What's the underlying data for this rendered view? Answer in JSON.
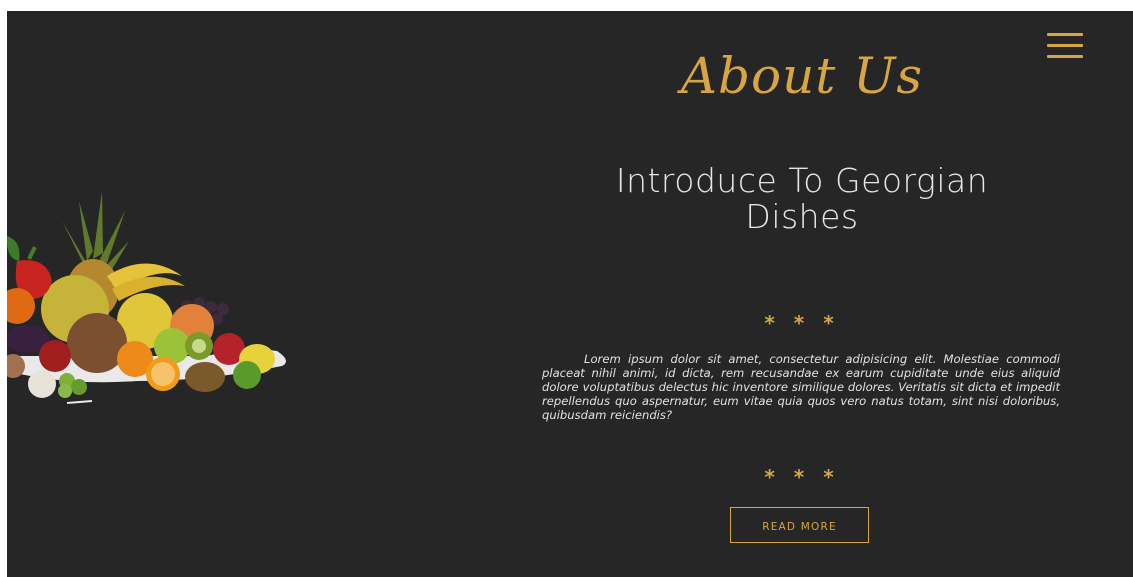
{
  "section": {
    "script_title": "About Us",
    "heading": "Introduce To Georgian Dishes",
    "stars_top": "* * *",
    "body": "Lorem ipsum dolor sit amet, consectetur adipisicing elit. Molestiae commodi placeat nihil animi, id dicta, rem recusandae ex earum cupiditate unde eius aliquid dolore voluptatibus delectus hic inventore similique dolores. Veritatis sit dicta et impedit repellendus quo aspernatur, eum vitae quia quos vero natus totam, sint nisi doloribus, quibusdam reiciendis?",
    "stars_bottom": "* * *",
    "button_label": "READ MORE"
  },
  "menu": {
    "icon": "hamburger-menu-icon"
  },
  "image": {
    "subject": "fruit-platter"
  },
  "colors": {
    "background": "#262626",
    "accent": "#d7a541",
    "text": "#e2e2e2"
  }
}
